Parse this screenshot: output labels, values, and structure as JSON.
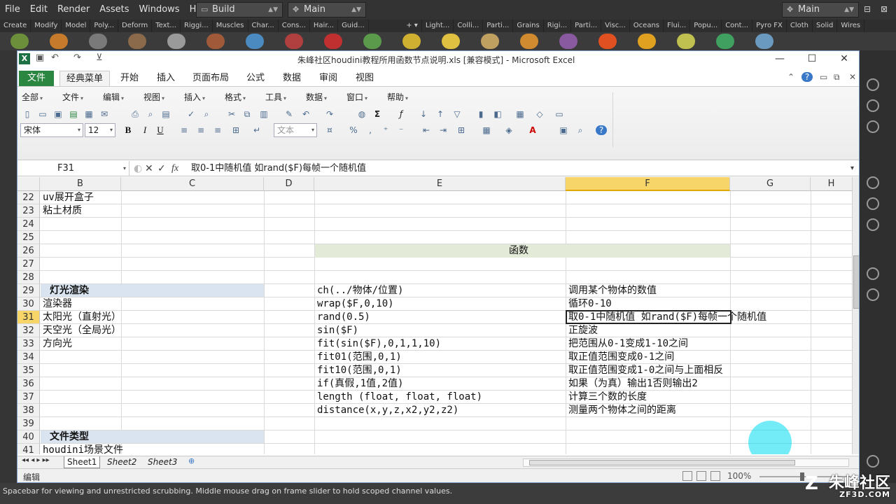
{
  "houdini": {
    "menu": [
      "File",
      "Edit",
      "Render",
      "Assets",
      "Windows",
      "Help"
    ],
    "desktop_combo": "Build",
    "network_combo": "Main",
    "right_combo": "Main",
    "shelf_tabs_left": [
      "Create",
      "Modify",
      "Model",
      "Poly...",
      "Deform",
      "Text...",
      "Riggi...",
      "Muscles",
      "Char...",
      "Cons...",
      "Hair...",
      "Guid..."
    ],
    "shelf_tabs_right": [
      "Light...",
      "Colli...",
      "Parti...",
      "Grains",
      "Rigi...",
      "Parti...",
      "Visc...",
      "Oceans",
      "Flui...",
      "Popu...",
      "Cont...",
      "Pyro FX",
      "Cloth",
      "Solid",
      "Wires"
    ],
    "status_text": "Spacebar for viewing and unrestricted scrubbing. Middle mouse drag on frame slider to hold scoped channel values.",
    "watermark": "朱峰社区",
    "watermark_url": "ZF3D.COM"
  },
  "excel": {
    "title": "朱峰社区houdini教程所用函数节点说明.xls  [兼容模式]  -  Microsoft Excel",
    "tabs": [
      "文件",
      "经典菜单",
      "开始",
      "插入",
      "页面布局",
      "公式",
      "数据",
      "审阅",
      "视图"
    ],
    "classic_menu": [
      "全部",
      "文件",
      "编辑",
      "视图",
      "插入",
      "格式",
      "工具",
      "数据",
      "窗口",
      "帮助"
    ],
    "font_name": "宋体",
    "font_size": "12",
    "bold_label": "B",
    "italic_label": "I",
    "underline_label": "U",
    "number_format": "文本",
    "percent_label": "%",
    "comma_label": ",",
    "name_box": "F31",
    "formula_icon": "fx",
    "formula": "取0-1中随机值 如rand($F)每帧一个随机值",
    "columns": [
      "B",
      "C",
      "D",
      "E",
      "F",
      "G",
      "H"
    ],
    "selected_column": "F",
    "rows": [
      {
        "num": "22",
        "B": "uv展开盒子",
        "E": "",
        "F": ""
      },
      {
        "num": "23",
        "B": "粘土材质",
        "E": "",
        "F": ""
      },
      {
        "num": "24",
        "B": "",
        "E": "",
        "F": ""
      },
      {
        "num": "25",
        "B": "",
        "E": "",
        "F": ""
      },
      {
        "num": "26",
        "B": "",
        "E": "函数",
        "F": ""
      },
      {
        "num": "27",
        "B": "",
        "E": "",
        "F": ""
      },
      {
        "num": "28",
        "B": "",
        "E": "",
        "F": ""
      },
      {
        "num": "29",
        "B": "灯光渲染",
        "E": "ch(../物体/位置)",
        "F": "调用某个物体的数值"
      },
      {
        "num": "30",
        "B": "渲染器",
        "E": "wrap($F,0,10)",
        "F": "循环0-10"
      },
      {
        "num": "31",
        "B": "太阳光（直射光）",
        "E": "rand(0.5)",
        "F": "取0-1中随机值 如rand($F)每帧一个随机值"
      },
      {
        "num": "32",
        "B": "天空光（全局光）",
        "E": "sin($F)",
        "F": "正旋波"
      },
      {
        "num": "33",
        "B": "方向光",
        "E": "fit(sin($F),0,1,1,10)",
        "F": "把范围从0-1变成1-10之间"
      },
      {
        "num": "34",
        "B": "",
        "E": "fit01(范围,0,1)",
        "F": "取正值范围变成0-1之间"
      },
      {
        "num": "35",
        "B": "",
        "E": "fit10(范围,0,1)",
        "F": "取正值范围变成1-0之间与上面相反"
      },
      {
        "num": "36",
        "B": "",
        "E": "if(真假,1值,2值)",
        "F": "如果（为真）输出1否则输出2"
      },
      {
        "num": "37",
        "B": "",
        "E": "length (float, float, float)",
        "F": "计算三个数的长度"
      },
      {
        "num": "38",
        "B": "",
        "E": "distance(x,y,z,x2,y2,z2)",
        "F": "测量两个物体之间的距离"
      },
      {
        "num": "39",
        "B": "",
        "E": "",
        "F": ""
      },
      {
        "num": "40",
        "B": "文件类型",
        "E": "",
        "F": ""
      },
      {
        "num": "41",
        "B": "houdini场景文件",
        "E": "",
        "F": ""
      }
    ],
    "selected_row": "31",
    "sheets": [
      "Sheet1",
      "Sheet2",
      "Sheet3"
    ],
    "status_mode": "编辑",
    "zoom": "100%",
    "colors": {
      "header_selected": "#f7d568",
      "section_fill": "#d9e4f0",
      "function_fill": "#e3ead8",
      "file_tab": "#2a8640",
      "cursor_ring": "#00dcf0"
    }
  }
}
